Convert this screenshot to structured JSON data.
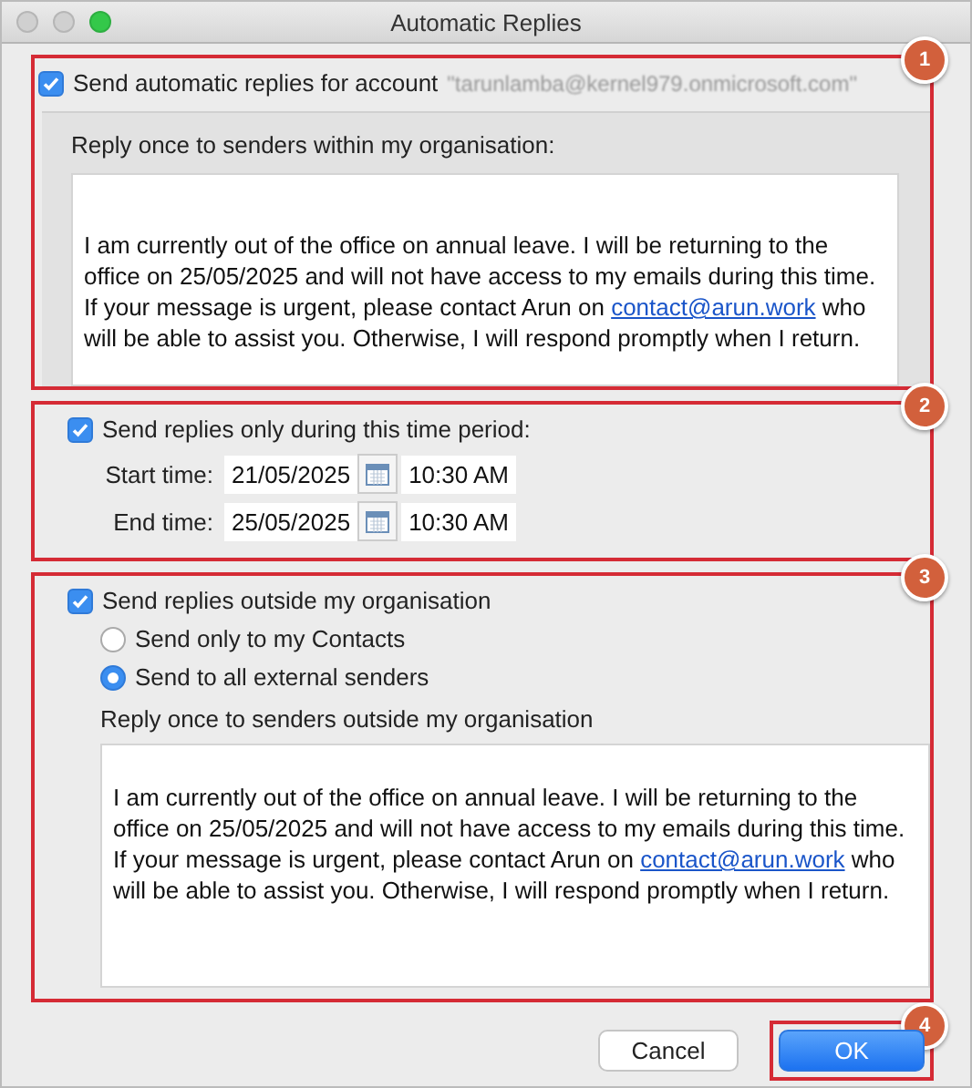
{
  "window": {
    "title": "Automatic Replies"
  },
  "window_buttons": [
    {
      "kind": "close",
      "active": false
    },
    {
      "kind": "minimize",
      "active": false
    },
    {
      "kind": "zoom",
      "active": true
    }
  ],
  "account_section": {
    "badge": "1",
    "checked": true,
    "label": "Send automatic replies for account",
    "account": "\"tarunlamba@kernel979.onmicrosoft.com\"",
    "reply_label": "Reply once to senders within my organisation:",
    "message": {
      "before": "I am currently out of the office on annual leave. I will be returning to the office on 25/05/2025 and will not have access to my emails during this time. If your message is urgent, please contact Arun on",
      "link": "contact@arun.work",
      "after": "who will be able to assist you. Otherwise, I will respond promptly when I return."
    }
  },
  "time_section": {
    "badge": "2",
    "checked": true,
    "label": "Send replies only during this time period:",
    "rows": [
      {
        "label": "Start time:",
        "date": "21/05/2025",
        "time": "10:30 AM"
      },
      {
        "label": "End time:",
        "date": "25/05/2025",
        "time": "10:30 AM"
      }
    ]
  },
  "outside_section": {
    "badge": "3",
    "checked": true,
    "label": "Send replies outside my organisation",
    "options": [
      {
        "label": "Send only to my Contacts",
        "selected": false
      },
      {
        "label": "Send to all external senders",
        "selected": true
      }
    ],
    "reply_label": "Reply once to senders outside my organisation",
    "message": {
      "before": "I am currently out of the office on annual leave. I will be returning to the office on 25/05/2025 and will not have access to my emails during this time. If your message is urgent, please contact Arun on",
      "link": "contact@arun.work",
      "after": "who will be able to assist you. Otherwise, I will respond promptly when I return."
    }
  },
  "buttons": [
    {
      "label": "Cancel",
      "kind": "secondary"
    },
    {
      "label": "OK",
      "kind": "primary",
      "badge": "4"
    }
  ]
}
